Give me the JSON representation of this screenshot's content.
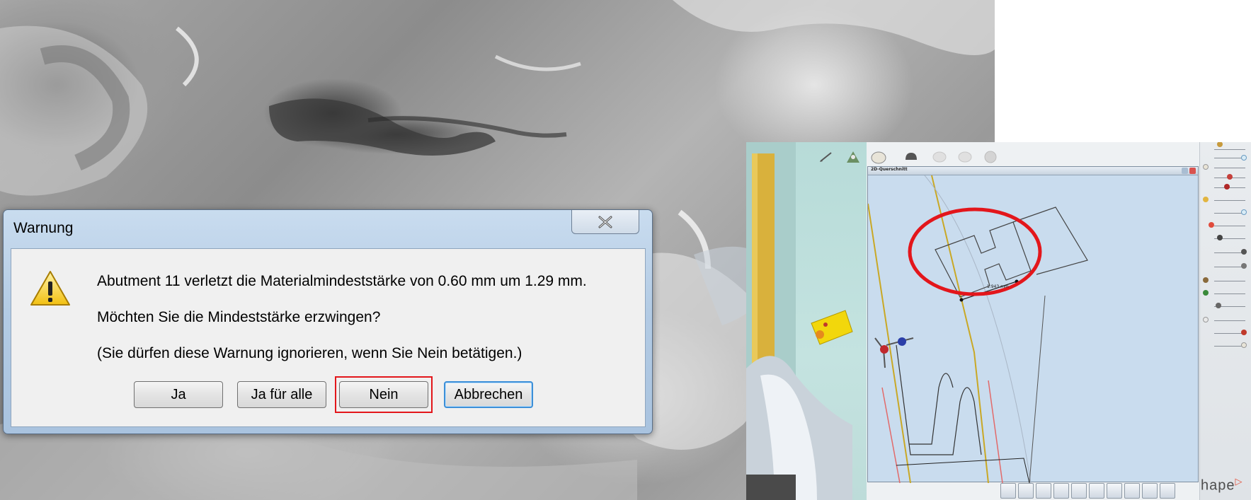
{
  "dialog": {
    "title": "Warnung",
    "close_label": "×",
    "messages": [
      "Abutment 11 verletzt die Materialmindeststärke von 0.60 mm um 1.29 mm.",
      "Möchten Sie die Mindeststärke erzwingen?",
      "(Sie dürfen diese Warnung ignorieren, wenn Sie Nein betätigen.)"
    ],
    "buttons": {
      "yes": "Ja",
      "yes_all": "Ja für alle",
      "no": "Nein",
      "cancel": "Abbrechen"
    },
    "highlight_color": "#e3161b",
    "icon": "warning-triangle-icon"
  },
  "cad": {
    "section_window_title": "2D-Querschnitt",
    "measurement": "1.943 mm",
    "brand": "hape",
    "highlight_color": "#e3161b",
    "accent_yellow": "#f2d70c",
    "toolbar_icons": [
      "pen-icon",
      "preparation-icon",
      "crown-icon",
      "abutment-icon",
      "tooth-icon",
      "tooth-icon",
      "sphere-icon"
    ],
    "bottom_icons": [
      "eraser-icon",
      "view-icon",
      "view-icon",
      "person-icon",
      "view-icon",
      "view-icon",
      "save-icon",
      "tool-icon",
      "magnify-icon",
      "grid-icon"
    ]
  }
}
